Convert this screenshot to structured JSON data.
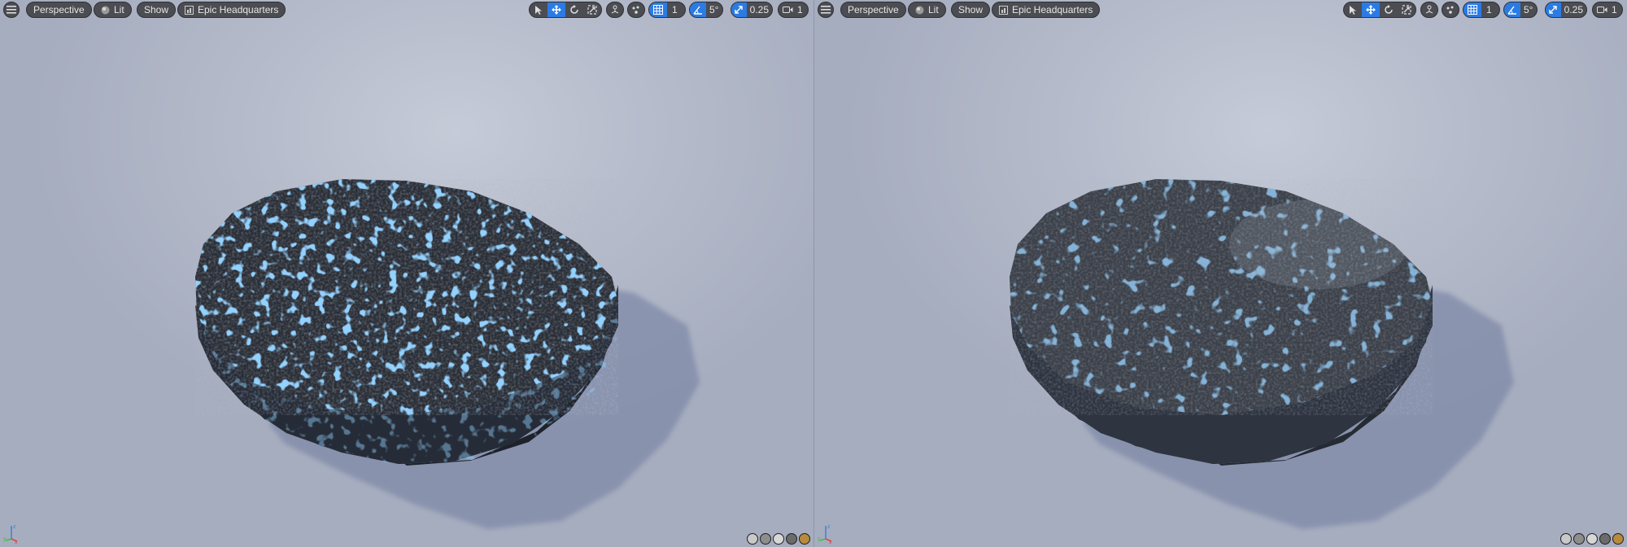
{
  "viewports": [
    {
      "perspective_label": "Perspective",
      "lit_label": "Lit",
      "show_label": "Show",
      "level_label": "Epic Headquarters",
      "grid_value": "1",
      "angle_value": "5°",
      "scale_value": "0.25",
      "camera_speed_value": "1"
    },
    {
      "perspective_label": "Perspective",
      "lit_label": "Lit",
      "show_label": "Show",
      "level_label": "Epic Headquarters",
      "grid_value": "1",
      "angle_value": "5°",
      "scale_value": "0.25",
      "camera_speed_value": "1"
    }
  ],
  "axis_labels": {
    "x": "x",
    "y": "y",
    "z": "z"
  },
  "colors": {
    "accent": "#2b7be4",
    "toolbar_bg": "#4b4d52",
    "toolbar_text": "#e6e6e6",
    "background": "#b6bccb",
    "speckle_blue": "#4aa3ff",
    "puck_dark": "#22262e",
    "shadow": "#7f8aa8"
  },
  "icons": [
    "hamburger-menu-icon",
    "lit-sphere-icon",
    "level-icon",
    "select-icon",
    "move-icon",
    "rotate-icon",
    "scale-icon",
    "world-local-icon",
    "surface-snap-icon",
    "grid-snap-icon",
    "angle-snap-icon",
    "scale-snap-icon",
    "camera-speed-icon",
    "axis-gizmo-icon"
  ]
}
